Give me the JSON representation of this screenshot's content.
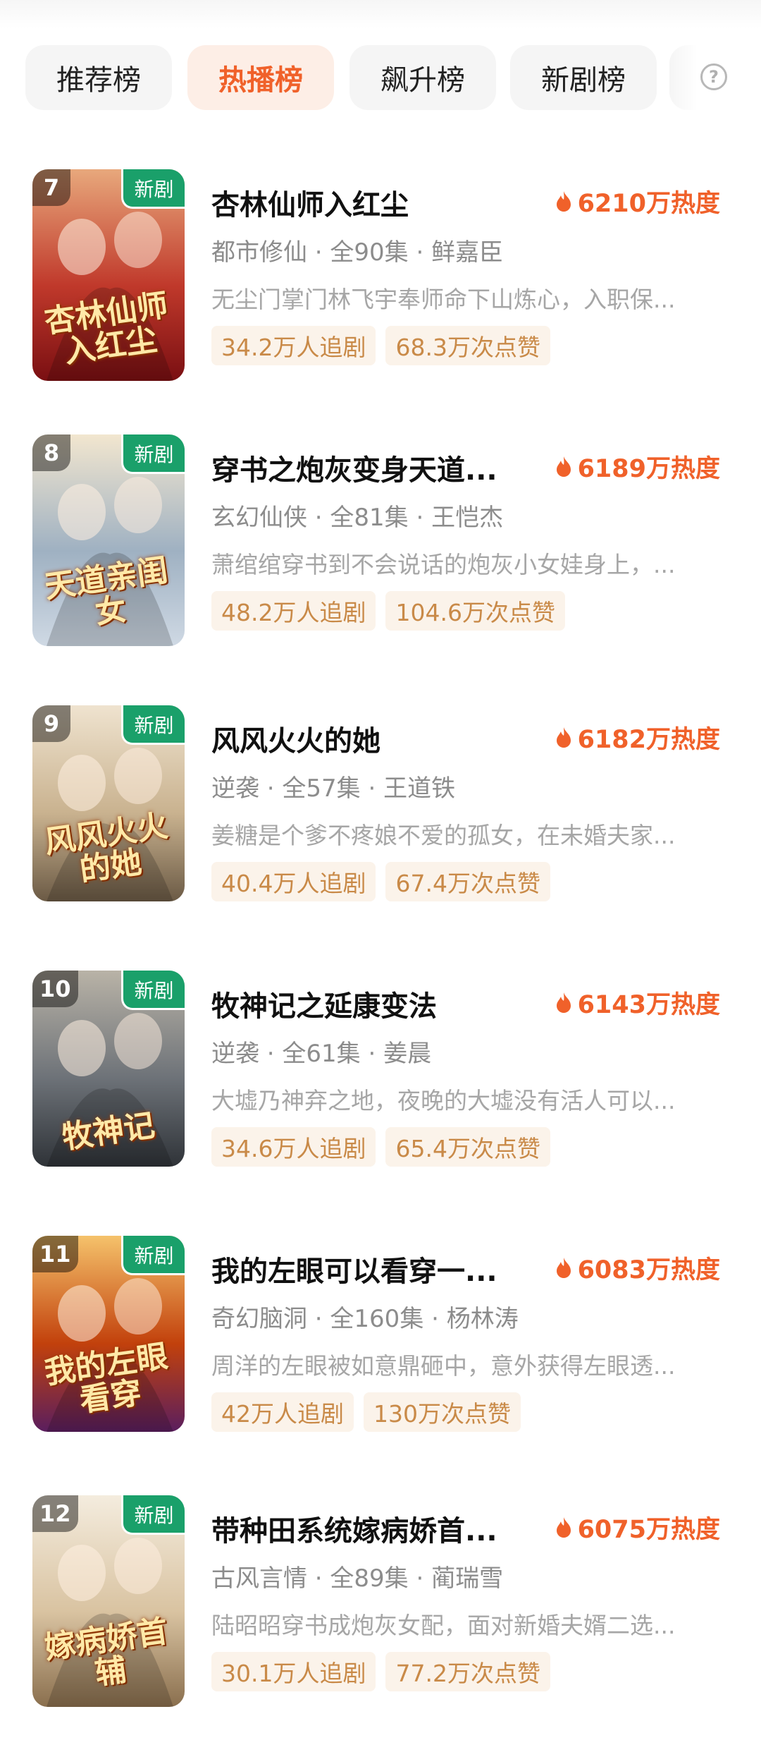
{
  "tabs": [
    {
      "label": "推荐榜",
      "active": false
    },
    {
      "label": "热播榜",
      "active": true
    },
    {
      "label": "飙升榜",
      "active": false
    },
    {
      "label": "新剧榜",
      "active": false
    }
  ],
  "help_icon": "question-circle-icon",
  "new_badge_label": "新剧",
  "items": [
    {
      "rank": "7",
      "title": "杏林仙师入红尘",
      "heat": "6210万热度",
      "meta": "都市修仙 · 全90集 · 鲜嘉臣",
      "desc": "无尘门掌门林飞宇奉师命下山炼心，入职保...",
      "followers": "34.2万人追剧",
      "likes": "68.3万次点赞",
      "poster_text": "杏林仙师入红尘",
      "colors": [
        "#7a0f12",
        "#c0392b",
        "#e8a87c"
      ]
    },
    {
      "rank": "8",
      "title": "穿书之炮灰变身天道...",
      "heat": "6189万热度",
      "meta": "玄幻仙侠 · 全81集 · 王恺杰",
      "desc": "萧绾绾穿书到不会说话的炮灰小女娃身上，...",
      "followers": "48.2万人追剧",
      "likes": "104.6万次点赞",
      "poster_text": "天道亲闺女",
      "colors": [
        "#cfd9e4",
        "#9fb1c2",
        "#f2e6cf"
      ]
    },
    {
      "rank": "9",
      "title": "风风火火的她",
      "heat": "6182万热度",
      "meta": "逆袭 · 全57集 · 王道铁",
      "desc": "姜糖是个爹不疼娘不爱的孤女，在未婚夫家...",
      "followers": "40.4万人追剧",
      "likes": "67.4万次点赞",
      "poster_text": "风风火火的她",
      "colors": [
        "#6b5a45",
        "#c9b28f",
        "#efe3cf"
      ]
    },
    {
      "rank": "10",
      "title": "牧神记之延康变法",
      "heat": "6143万热度",
      "meta": "逆袭 · 全61集 · 姜晨",
      "desc": "大墟乃神弃之地，夜晚的大墟没有活人可以...",
      "followers": "34.6万人追剧",
      "likes": "65.4万次点赞",
      "poster_text": "牧神记",
      "colors": [
        "#2f3338",
        "#6d7278",
        "#b9b3a7"
      ]
    },
    {
      "rank": "11",
      "title": "我的左眼可以看穿一...",
      "heat": "6083万热度",
      "meta": "奇幻脑洞 · 全160集 · 杨林涛",
      "desc": "周洋的左眼被如意鼎砸中，意外获得左眼透...",
      "followers": "42万人追剧",
      "likes": "130万次点赞",
      "poster_text": "我的左眼看穿",
      "colors": [
        "#5a1e5e",
        "#c2410c",
        "#f5c26b"
      ]
    },
    {
      "rank": "12",
      "title": "带种田系统嫁病娇首...",
      "heat": "6075万热度",
      "meta": "古风言情 · 全89集 · 蔺瑞雪",
      "desc": "陆昭昭穿书成炮灰女配，面对新婚夫婿二选...",
      "followers": "30.1万人追剧",
      "likes": "77.2万次点赞",
      "poster_text": "嫁病娇首辅",
      "colors": [
        "#8a6f4e",
        "#d9c3a1",
        "#f4ecde"
      ]
    }
  ]
}
